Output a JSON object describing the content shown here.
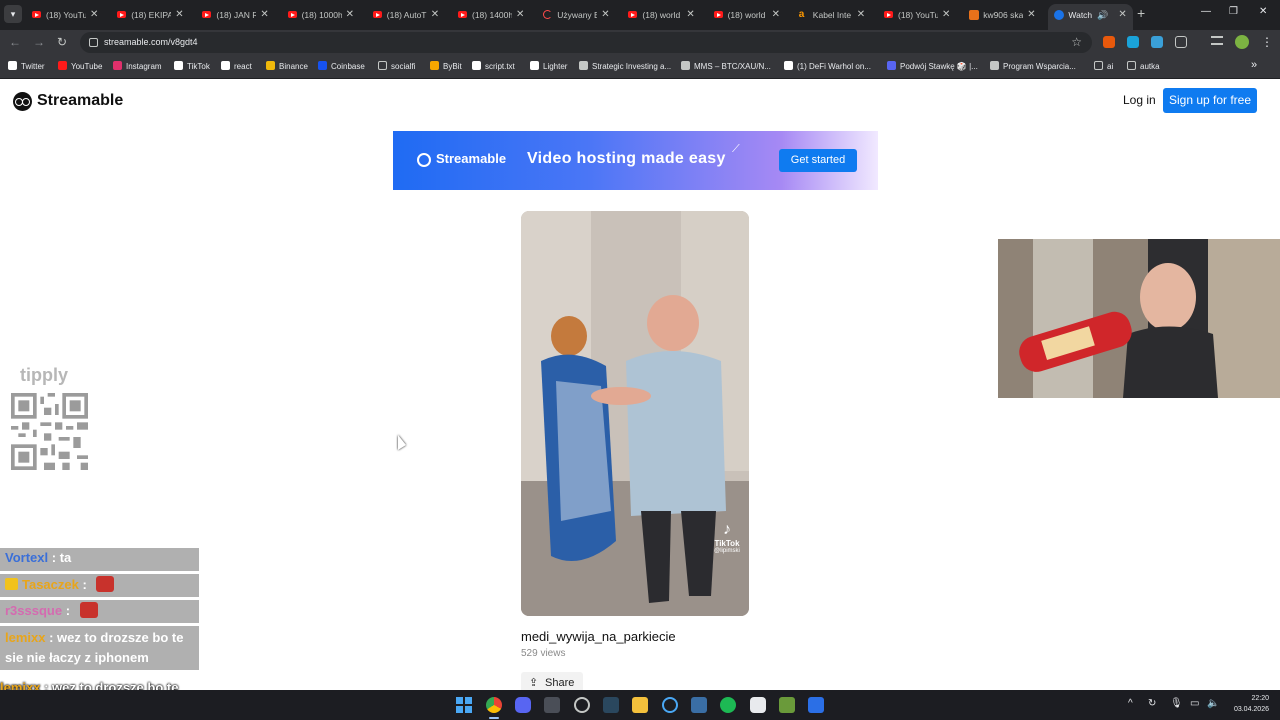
{
  "browser": {
    "tabs": [
      {
        "title": "(18) YouTu",
        "icon": "youtube-icon"
      },
      {
        "title": "(18) EKIPA",
        "icon": "youtube-icon"
      },
      {
        "title": "(18) JAN R",
        "icon": "youtube-icon"
      },
      {
        "title": "(18) 1000h",
        "icon": "youtube-icon"
      },
      {
        "title": "(18) AutoT",
        "icon": "youtube-icon"
      },
      {
        "title": "(18) 1400h",
        "icon": "youtube-icon"
      },
      {
        "title": "Używany E",
        "icon": "loading-icon"
      },
      {
        "title": "(18) world",
        "icon": "youtube-icon"
      },
      {
        "title": "(18) world",
        "icon": "youtube-icon"
      },
      {
        "title": "Kabel Inte",
        "icon": "amazon-icon"
      },
      {
        "title": "(18) YouTu",
        "icon": "youtube-icon"
      },
      {
        "title": "kw906 ska",
        "icon": "site-icon"
      },
      {
        "title": "Watch",
        "icon": "streamable-icon",
        "active": true
      }
    ],
    "url": "streamable.com/v8gdt4",
    "bookmarks": [
      {
        "label": "Twitter",
        "icon": "x-icon",
        "color": "#ffffff"
      },
      {
        "label": "YouTube",
        "icon": "youtube-icon",
        "color": "#ff1a1a"
      },
      {
        "label": "Instagram",
        "icon": "instagram-icon",
        "color": "#e1306c"
      },
      {
        "label": "TikTok",
        "icon": "tiktok-icon",
        "color": "#ffffff"
      },
      {
        "label": "react",
        "icon": "tiktok-icon",
        "color": "#ffffff"
      },
      {
        "label": "Binance",
        "icon": "binance-icon",
        "color": "#f0b90b"
      },
      {
        "label": "Coinbase",
        "icon": "coinbase-icon",
        "color": "#1652f0"
      },
      {
        "label": "socialfi",
        "icon": "folder-icon",
        "color": "#c4c7c5"
      },
      {
        "label": "ByBit",
        "icon": "bybit-icon",
        "color": "#f7a600"
      },
      {
        "label": "script.txt",
        "icon": "github-icon",
        "color": "#ffffff"
      },
      {
        "label": "Lighter",
        "icon": "lighter-icon",
        "color": "#ffffff"
      },
      {
        "label": "Strategic Investing a...",
        "icon": "loading-icon",
        "color": "#c4c7c5"
      },
      {
        "label": "MMS – BTC/XAU/N...",
        "icon": "globe-icon",
        "color": "#c4c7c5"
      },
      {
        "label": "(1) DeFi Warhol on...",
        "icon": "x-icon",
        "color": "#ffffff"
      },
      {
        "label": "Podwój Stawkę 🎲 |...",
        "icon": "discord-icon",
        "color": "#5865f2"
      },
      {
        "label": "Program Wsparcia...",
        "icon": "site-icon",
        "color": "#c4c7c5"
      },
      {
        "label": "ai",
        "icon": "folder-icon",
        "color": "#c4c7c5"
      },
      {
        "label": "autka",
        "icon": "folder-icon",
        "color": "#c4c7c5"
      }
    ]
  },
  "page": {
    "logo_text": "Streamable",
    "login_label": "Log in",
    "signup_label": "Sign up for free",
    "banner": {
      "brand": "Streamable",
      "tagline": "Video hosting made easy",
      "cta": "Get started"
    },
    "video": {
      "title": "medi_wywija_na_parkiecie",
      "views": "529 views",
      "share_label": "Share",
      "watermark_name": "TikTok",
      "watermark_user": "@lipimski"
    }
  },
  "overlay": {
    "tipply_text": "tipply",
    "chat": [
      {
        "user": "Vortexl",
        "user_color": "#3a6fd8",
        "message": "ta",
        "emote": false,
        "crown": false
      },
      {
        "user": "Tasaczek",
        "user_color": "#e8a51a",
        "message": "",
        "emote": true,
        "crown": true
      },
      {
        "user": "r3sssque",
        "user_color": "#d46bb0",
        "message": "",
        "emote": true,
        "crown": false
      },
      {
        "user": "lemixx",
        "user_color": "#e8a51a",
        "message": "wez to drozsze bo te sie nie łaczy z iphonem",
        "emote": false,
        "crown": false
      }
    ],
    "chat_duplicate": {
      "user": "lemixx",
      "message": "wez to drozsze bo te sie nie łaczy z iphonem"
    }
  },
  "taskbar": {
    "clock_time": "22:20",
    "clock_date": "03.04.2026"
  }
}
